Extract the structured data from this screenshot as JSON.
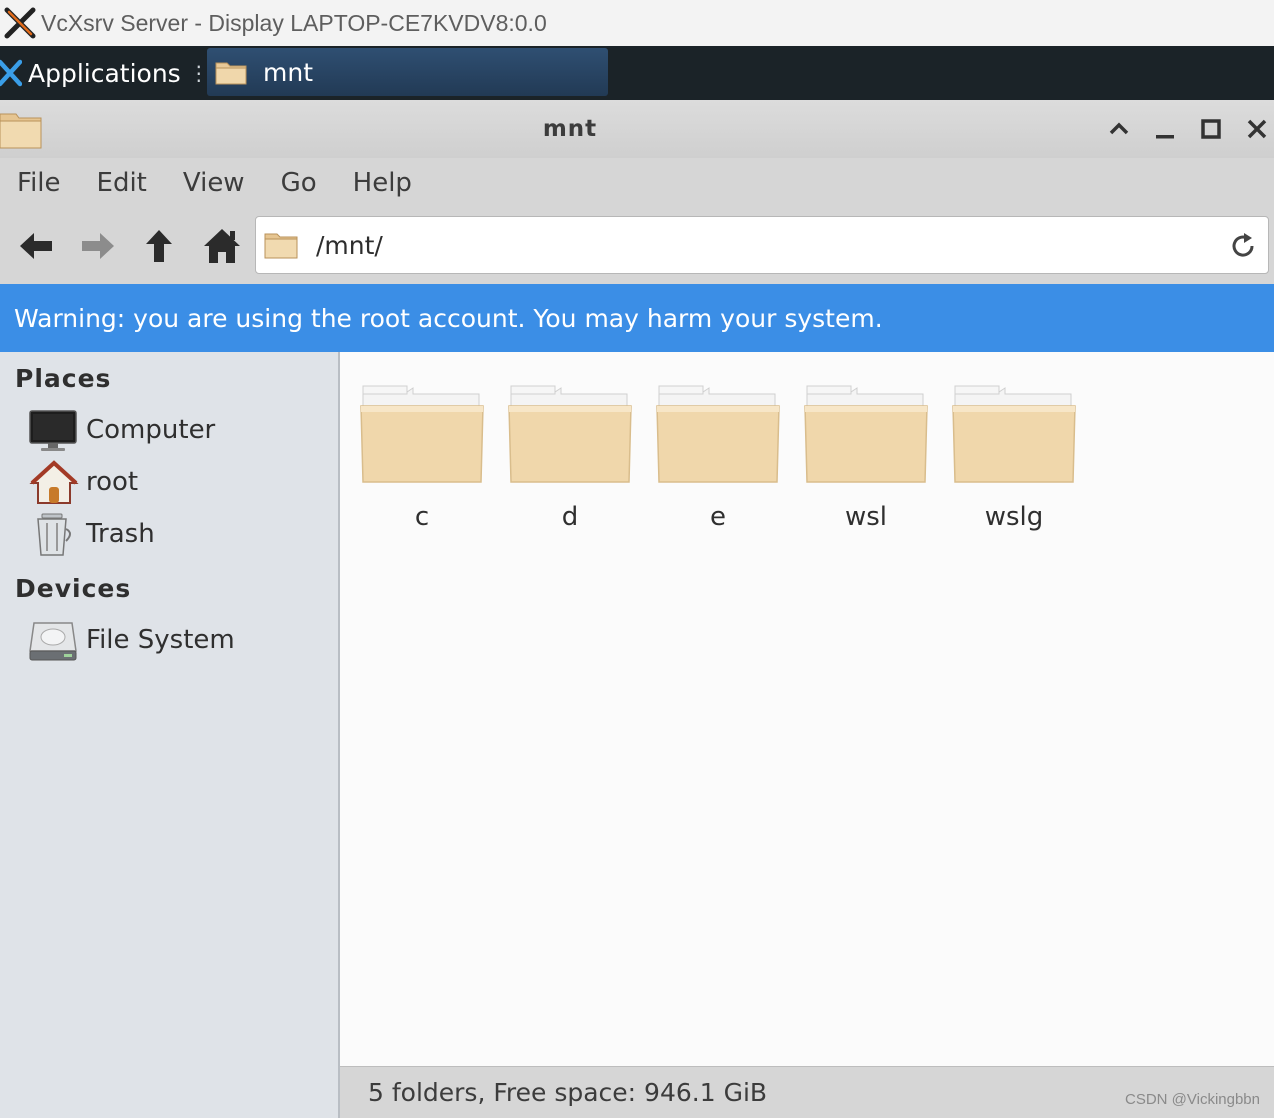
{
  "host_window": {
    "title": "VcXsrv Server - Display LAPTOP-CE7KVDV8:0.0",
    "logo_icon": "x-logo-icon"
  },
  "panel": {
    "applications_label": "Applications",
    "applications_icon": "xfce-x-icon",
    "separator": "⋮",
    "task": {
      "label": "mnt",
      "icon": "folder-icon"
    }
  },
  "window": {
    "title": "mnt",
    "icon": "folder-icon",
    "controls": [
      "shade-icon",
      "minimize-icon",
      "maximize-icon",
      "close-icon"
    ]
  },
  "menu": {
    "items": [
      "File",
      "Edit",
      "View",
      "Go",
      "Help"
    ]
  },
  "toolbar": {
    "buttons": [
      "back-arrow-icon",
      "forward-arrow-icon",
      "up-arrow-icon",
      "home-icon"
    ],
    "location": "/mnt/",
    "reload_icon": "reload-icon"
  },
  "warning": {
    "text": "Warning: you are using the root account. You may harm your system."
  },
  "sidebar": {
    "places_heading": "Places",
    "places": [
      {
        "label": "Computer",
        "icon": "computer-icon"
      },
      {
        "label": "root",
        "icon": "home-icon"
      },
      {
        "label": "Trash",
        "icon": "trash-icon"
      }
    ],
    "devices_heading": "Devices",
    "devices": [
      {
        "label": "File System",
        "icon": "harddisk-icon"
      }
    ]
  },
  "files": [
    "c",
    "d",
    "e",
    "wsl",
    "wslg"
  ],
  "status": {
    "text": "5 folders, Free space: 946.1 GiB"
  },
  "watermark": "CSDN @Vickingbbn",
  "colors": {
    "panel": "#1b2328",
    "warning": "#3b8ee6",
    "sidebar": "#dfe3e8",
    "folder": "#f0d7ab"
  }
}
